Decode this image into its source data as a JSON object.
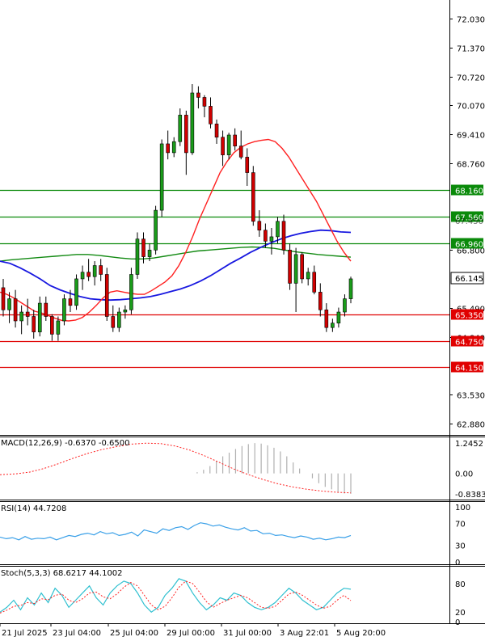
{
  "colors": {
    "bull": "#1a9c1a",
    "bear": "#d00000",
    "ma_fast": "#ff2020",
    "ma_mid": "#1818e0",
    "ma_slow": "#128a12",
    "level_green": "#0a8a0a",
    "level_red": "#e00000",
    "macd_hist": "#b0b0b0",
    "macd_signal": "#ff2020",
    "rsi": "#3aa0e8",
    "stoch_main": "#30c0d0",
    "stoch_signal": "#ff2020",
    "grid_frame": "#000000",
    "price_box_bg": "#ffffff"
  },
  "price_axis": {
    "ticks": [
      "72.030",
      "71.370",
      "70.720",
      "70.070",
      "69.410",
      "68.760",
      "66.800",
      "65.490",
      "64.840",
      "63.530",
      "62.880"
    ],
    "tick_values": [
      72.03,
      71.37,
      70.72,
      70.07,
      69.41,
      68.76,
      66.8,
      65.49,
      64.84,
      63.53,
      62.88
    ],
    "partial_tick": "67.450",
    "current_price": "66.145",
    "current_price_value": 66.145
  },
  "levels": [
    {
      "label": "68.160",
      "value": 68.16,
      "type": "resistance"
    },
    {
      "label": "67.560",
      "value": 67.56,
      "type": "resistance"
    },
    {
      "label": "66.960",
      "value": 66.96,
      "type": "resistance"
    },
    {
      "label": "65.350",
      "value": 65.35,
      "type": "support"
    },
    {
      "label": "64.750",
      "value": 64.75,
      "type": "support"
    },
    {
      "label": "64.150",
      "value": 64.15,
      "type": "support"
    }
  ],
  "time_axis": {
    "labels": [
      "21 Jul 2025",
      "23 Jul 04:00",
      "25 Jul 04:00",
      "29 Jul 00:00",
      "31 Jul 00:00",
      "3 Aug 22:01",
      "5 Aug 20:00"
    ]
  },
  "panels": {
    "macd": {
      "title": "MACD(12,26,9) -0.6370 -0.6500",
      "ticks": [
        "1.2452",
        "0.00",
        "-0.8383"
      ],
      "tick_values": [
        1.2452,
        0,
        -0.8383
      ]
    },
    "rsi": {
      "title": "RSI(14) 44.7208",
      "ticks": [
        "100",
        "70",
        "30",
        "0"
      ],
      "tick_values": [
        100,
        70,
        30,
        0
      ]
    },
    "stoch": {
      "title": "Stoch(5,3,3) 68.6217 44.1002",
      "ticks": [
        "80",
        "20",
        "0"
      ],
      "tick_values": [
        80,
        20,
        0
      ]
    }
  },
  "chart_data": {
    "type": "candlestick",
    "candles": [
      {
        "o": 65.95,
        "h": 66.15,
        "l": 65.3,
        "c": 65.45
      },
      {
        "o": 65.45,
        "h": 65.85,
        "l": 65.15,
        "c": 65.7
      },
      {
        "o": 65.7,
        "h": 65.9,
        "l": 65.05,
        "c": 65.2
      },
      {
        "o": 65.2,
        "h": 65.55,
        "l": 64.9,
        "c": 65.4
      },
      {
        "o": 65.4,
        "h": 65.7,
        "l": 65.1,
        "c": 65.3
      },
      {
        "o": 65.3,
        "h": 65.45,
        "l": 64.8,
        "c": 64.95
      },
      {
        "o": 64.95,
        "h": 65.75,
        "l": 64.85,
        "c": 65.6
      },
      {
        "o": 65.6,
        "h": 65.75,
        "l": 65.2,
        "c": 65.3
      },
      {
        "o": 65.3,
        "h": 65.35,
        "l": 64.75,
        "c": 64.9
      },
      {
        "o": 64.9,
        "h": 65.3,
        "l": 64.75,
        "c": 65.2
      },
      {
        "o": 65.2,
        "h": 65.8,
        "l": 65.1,
        "c": 65.7
      },
      {
        "o": 65.7,
        "h": 65.9,
        "l": 65.4,
        "c": 65.55
      },
      {
        "o": 65.55,
        "h": 66.25,
        "l": 65.45,
        "c": 66.15
      },
      {
        "o": 66.15,
        "h": 66.45,
        "l": 65.9,
        "c": 66.3
      },
      {
        "o": 66.3,
        "h": 66.6,
        "l": 66.1,
        "c": 66.2
      },
      {
        "o": 66.2,
        "h": 66.55,
        "l": 66.0,
        "c": 66.45
      },
      {
        "o": 66.45,
        "h": 66.6,
        "l": 66.1,
        "c": 66.25
      },
      {
        "o": 66.25,
        "h": 66.4,
        "l": 65.2,
        "c": 65.3
      },
      {
        "o": 65.3,
        "h": 65.55,
        "l": 64.95,
        "c": 65.05
      },
      {
        "o": 65.05,
        "h": 65.5,
        "l": 64.95,
        "c": 65.4
      },
      {
        "o": 65.4,
        "h": 65.55,
        "l": 65.25,
        "c": 65.45
      },
      {
        "o": 65.45,
        "h": 66.4,
        "l": 65.35,
        "c": 66.25
      },
      {
        "o": 66.25,
        "h": 67.2,
        "l": 66.15,
        "c": 67.05
      },
      {
        "o": 67.05,
        "h": 67.2,
        "l": 66.5,
        "c": 66.65
      },
      {
        "o": 66.65,
        "h": 66.95,
        "l": 66.55,
        "c": 66.8
      },
      {
        "o": 66.8,
        "h": 67.8,
        "l": 66.7,
        "c": 67.7
      },
      {
        "o": 67.7,
        "h": 69.3,
        "l": 67.55,
        "c": 69.2
      },
      {
        "o": 69.2,
        "h": 69.5,
        "l": 68.85,
        "c": 69.0
      },
      {
        "o": 69.0,
        "h": 69.35,
        "l": 68.9,
        "c": 69.25
      },
      {
        "o": 69.25,
        "h": 70.0,
        "l": 69.15,
        "c": 69.85
      },
      {
        "o": 69.85,
        "h": 69.95,
        "l": 68.5,
        "c": 69.0
      },
      {
        "o": 69.0,
        "h": 70.55,
        "l": 68.95,
        "c": 70.35
      },
      {
        "o": 70.35,
        "h": 70.5,
        "l": 70.0,
        "c": 70.25
      },
      {
        "o": 70.25,
        "h": 70.3,
        "l": 69.8,
        "c": 70.05
      },
      {
        "o": 70.05,
        "h": 70.25,
        "l": 69.55,
        "c": 69.65
      },
      {
        "o": 69.65,
        "h": 69.75,
        "l": 69.2,
        "c": 69.35
      },
      {
        "o": 69.35,
        "h": 69.5,
        "l": 68.7,
        "c": 68.95
      },
      {
        "o": 68.95,
        "h": 69.45,
        "l": 68.85,
        "c": 69.4
      },
      {
        "o": 69.4,
        "h": 69.55,
        "l": 69.05,
        "c": 69.15
      },
      {
        "o": 69.15,
        "h": 69.5,
        "l": 68.85,
        "c": 68.9
      },
      {
        "o": 68.9,
        "h": 69.1,
        "l": 68.25,
        "c": 68.55
      },
      {
        "o": 68.55,
        "h": 68.7,
        "l": 67.35,
        "c": 67.45
      },
      {
        "o": 67.45,
        "h": 67.7,
        "l": 67.1,
        "c": 67.25
      },
      {
        "o": 67.25,
        "h": 67.4,
        "l": 66.85,
        "c": 67.0
      },
      {
        "o": 67.0,
        "h": 67.3,
        "l": 66.7,
        "c": 67.1
      },
      {
        "o": 67.1,
        "h": 67.55,
        "l": 66.95,
        "c": 67.45
      },
      {
        "o": 67.45,
        "h": 67.6,
        "l": 66.7,
        "c": 66.8
      },
      {
        "o": 66.8,
        "h": 66.95,
        "l": 65.9,
        "c": 66.05
      },
      {
        "o": 66.05,
        "h": 66.85,
        "l": 65.4,
        "c": 66.7
      },
      {
        "o": 66.7,
        "h": 66.75,
        "l": 66.05,
        "c": 66.15
      },
      {
        "o": 66.15,
        "h": 66.4,
        "l": 66.0,
        "c": 66.3
      },
      {
        "o": 66.3,
        "h": 66.45,
        "l": 65.8,
        "c": 65.85
      },
      {
        "o": 65.85,
        "h": 66.05,
        "l": 65.3,
        "c": 65.45
      },
      {
        "o": 65.45,
        "h": 65.6,
        "l": 64.95,
        "c": 65.05
      },
      {
        "o": 65.05,
        "h": 65.25,
        "l": 64.95,
        "c": 65.15
      },
      {
        "o": 65.15,
        "h": 65.5,
        "l": 65.05,
        "c": 65.4
      },
      {
        "o": 65.4,
        "h": 65.8,
        "l": 65.3,
        "c": 65.7
      },
      {
        "o": 65.7,
        "h": 66.2,
        "l": 65.6,
        "c": 66.15
      }
    ],
    "ma_fast": [
      65.85,
      65.8,
      65.72,
      65.62,
      65.52,
      65.42,
      65.38,
      65.32,
      65.26,
      65.21,
      65.2,
      65.22,
      65.28,
      65.4,
      65.55,
      65.72,
      65.85,
      65.88,
      65.85,
      65.82,
      65.8,
      65.8,
      65.88,
      65.98,
      66.08,
      66.22,
      66.45,
      66.75,
      67.1,
      67.5,
      67.85,
      68.2,
      68.55,
      68.8,
      69.0,
      69.12,
      69.2,
      69.25,
      69.28,
      69.3,
      69.25,
      69.1,
      68.9,
      68.65,
      68.4,
      68.15,
      67.9,
      67.6,
      67.3,
      67.0,
      66.75,
      66.55
    ],
    "ma_mid": [
      66.55,
      66.5,
      66.4,
      66.28,
      66.15,
      66.0,
      65.9,
      65.82,
      65.75,
      65.7,
      65.68,
      65.67,
      65.68,
      65.7,
      65.72,
      65.75,
      65.8,
      65.86,
      65.92,
      66.0,
      66.1,
      66.22,
      66.36,
      66.5,
      66.62,
      66.75,
      66.86,
      66.96,
      67.05,
      67.12,
      67.18,
      67.22,
      67.25,
      67.24,
      67.21,
      67.2
    ],
    "ma_slow": [
      66.55,
      66.58,
      66.6,
      66.62,
      66.64,
      66.66,
      66.68,
      66.7,
      66.7,
      66.68,
      66.65,
      66.62,
      66.6,
      66.6,
      66.62,
      66.66,
      66.7,
      66.74,
      66.78,
      66.8,
      66.82,
      66.84,
      66.86,
      66.87,
      66.86,
      66.84,
      66.8,
      66.76,
      66.73,
      66.7,
      66.68,
      66.66,
      66.64
    ],
    "macd_hist": [
      0.0,
      0.05,
      0.15,
      0.3,
      0.5,
      0.7,
      0.85,
      1.0,
      1.12,
      1.2,
      1.24,
      1.22,
      1.15,
      1.05,
      0.9,
      0.7,
      0.45,
      0.2,
      0.0,
      -0.2,
      -0.4,
      -0.55,
      -0.65,
      -0.75,
      -0.82,
      -0.83
    ],
    "macd_signal": [
      -0.05,
      -0.02,
      0.05,
      0.2,
      0.4,
      0.62,
      0.82,
      0.98,
      1.1,
      1.2,
      1.24,
      1.22,
      1.12,
      0.95,
      0.72,
      0.45,
      0.18,
      -0.05,
      -0.25,
      -0.42,
      -0.55,
      -0.65,
      -0.72,
      -0.77,
      -0.8
    ],
    "rsi": [
      45,
      42,
      44,
      40,
      46,
      41,
      43,
      42,
      45,
      40,
      44,
      48,
      46,
      50,
      52,
      49,
      55,
      51,
      53,
      48,
      50,
      54,
      47,
      58,
      55,
      52,
      60,
      57,
      62,
      64,
      59,
      66,
      71,
      69,
      65,
      67,
      63,
      60,
      58,
      62,
      56,
      57,
      51,
      52,
      48,
      49,
      46,
      44,
      47,
      45,
      41,
      43,
      40,
      42,
      45,
      44,
      48
    ],
    "stoch_main": [
      20,
      30,
      45,
      25,
      50,
      35,
      60,
      40,
      70,
      55,
      30,
      45,
      60,
      75,
      50,
      35,
      60,
      75,
      85,
      80,
      60,
      35,
      20,
      30,
      55,
      70,
      90,
      85,
      60,
      40,
      25,
      35,
      50,
      45,
      60,
      55,
      40,
      30,
      25,
      30,
      40,
      55,
      70,
      60,
      45,
      35,
      25,
      30,
      45,
      60,
      70,
      68
    ],
    "stoch_signal": [
      18,
      24,
      32,
      34,
      40,
      38,
      48,
      46,
      55,
      58,
      45,
      40,
      48,
      60,
      62,
      52,
      48,
      58,
      72,
      82,
      75,
      55,
      35,
      25,
      32,
      50,
      72,
      85,
      80,
      62,
      42,
      30,
      38,
      45,
      50,
      55,
      50,
      40,
      30,
      28,
      32,
      45,
      58,
      62,
      55,
      45,
      35,
      28,
      32,
      45,
      55,
      44
    ]
  }
}
